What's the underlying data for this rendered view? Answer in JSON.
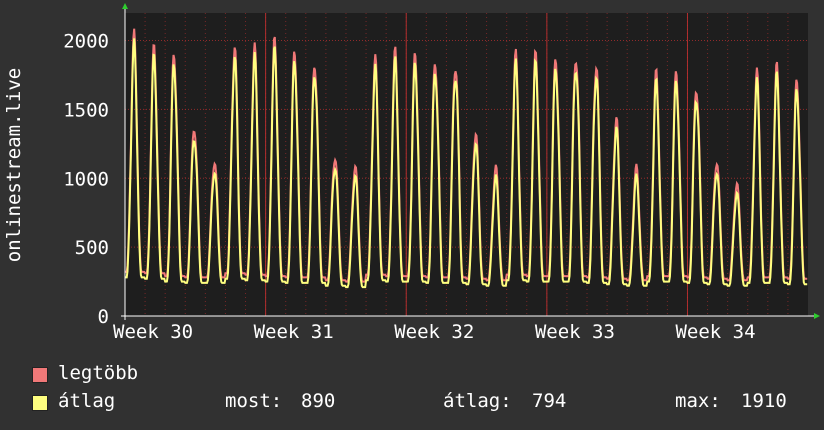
{
  "chart_data": {
    "type": "line",
    "ylabel": "onlinestream.live",
    "xlabel": "",
    "ylim": [
      0,
      2200
    ],
    "yticks": [
      0,
      500,
      1000,
      1500,
      2000
    ],
    "x_tick_labels": [
      "Week 30",
      "Week 31",
      "Week 32",
      "Week 33",
      "Week 34"
    ],
    "grid": true,
    "background": "#1e1e1e",
    "grid_color": "#c03030",
    "colors": {
      "max": "#f07878",
      "avg": "#ffff80",
      "frame_bg": "#313131"
    },
    "days": 34,
    "daily_peaks_avg": [
      1920,
      1840,
      1830,
      1330,
      1070,
      1860,
      1830,
      1880,
      1830,
      1800,
      1110,
      1020,
      1760,
      1800,
      1800,
      1800,
      1800,
      1270,
      1000,
      1780,
      1800,
      1810,
      1860,
      1780,
      1350,
      990,
      1660,
      1700,
      1620,
      1070,
      890,
      1660,
      1700,
      1620
    ],
    "daily_min_avg": [
      280,
      270,
      250,
      240,
      240,
      270,
      260,
      250,
      240,
      240,
      220,
      210,
      260,
      250,
      250,
      240,
      240,
      230,
      220,
      260,
      250,
      250,
      250,
      240,
      230,
      220,
      250,
      250,
      240,
      230,
      220,
      240,
      240,
      230
    ],
    "series": [
      {
        "name": "legtöbb",
        "key": "max"
      },
      {
        "name": "átlag",
        "key": "avg"
      }
    ]
  },
  "legend": {
    "max_label": "legtöbb",
    "avg_label": "átlag",
    "now_label": "most:",
    "now_value": "890",
    "avg_stat_label": "átlag:",
    "avg_stat_value": "794",
    "max_stat_label": "max:",
    "max_stat_value": "1910"
  }
}
